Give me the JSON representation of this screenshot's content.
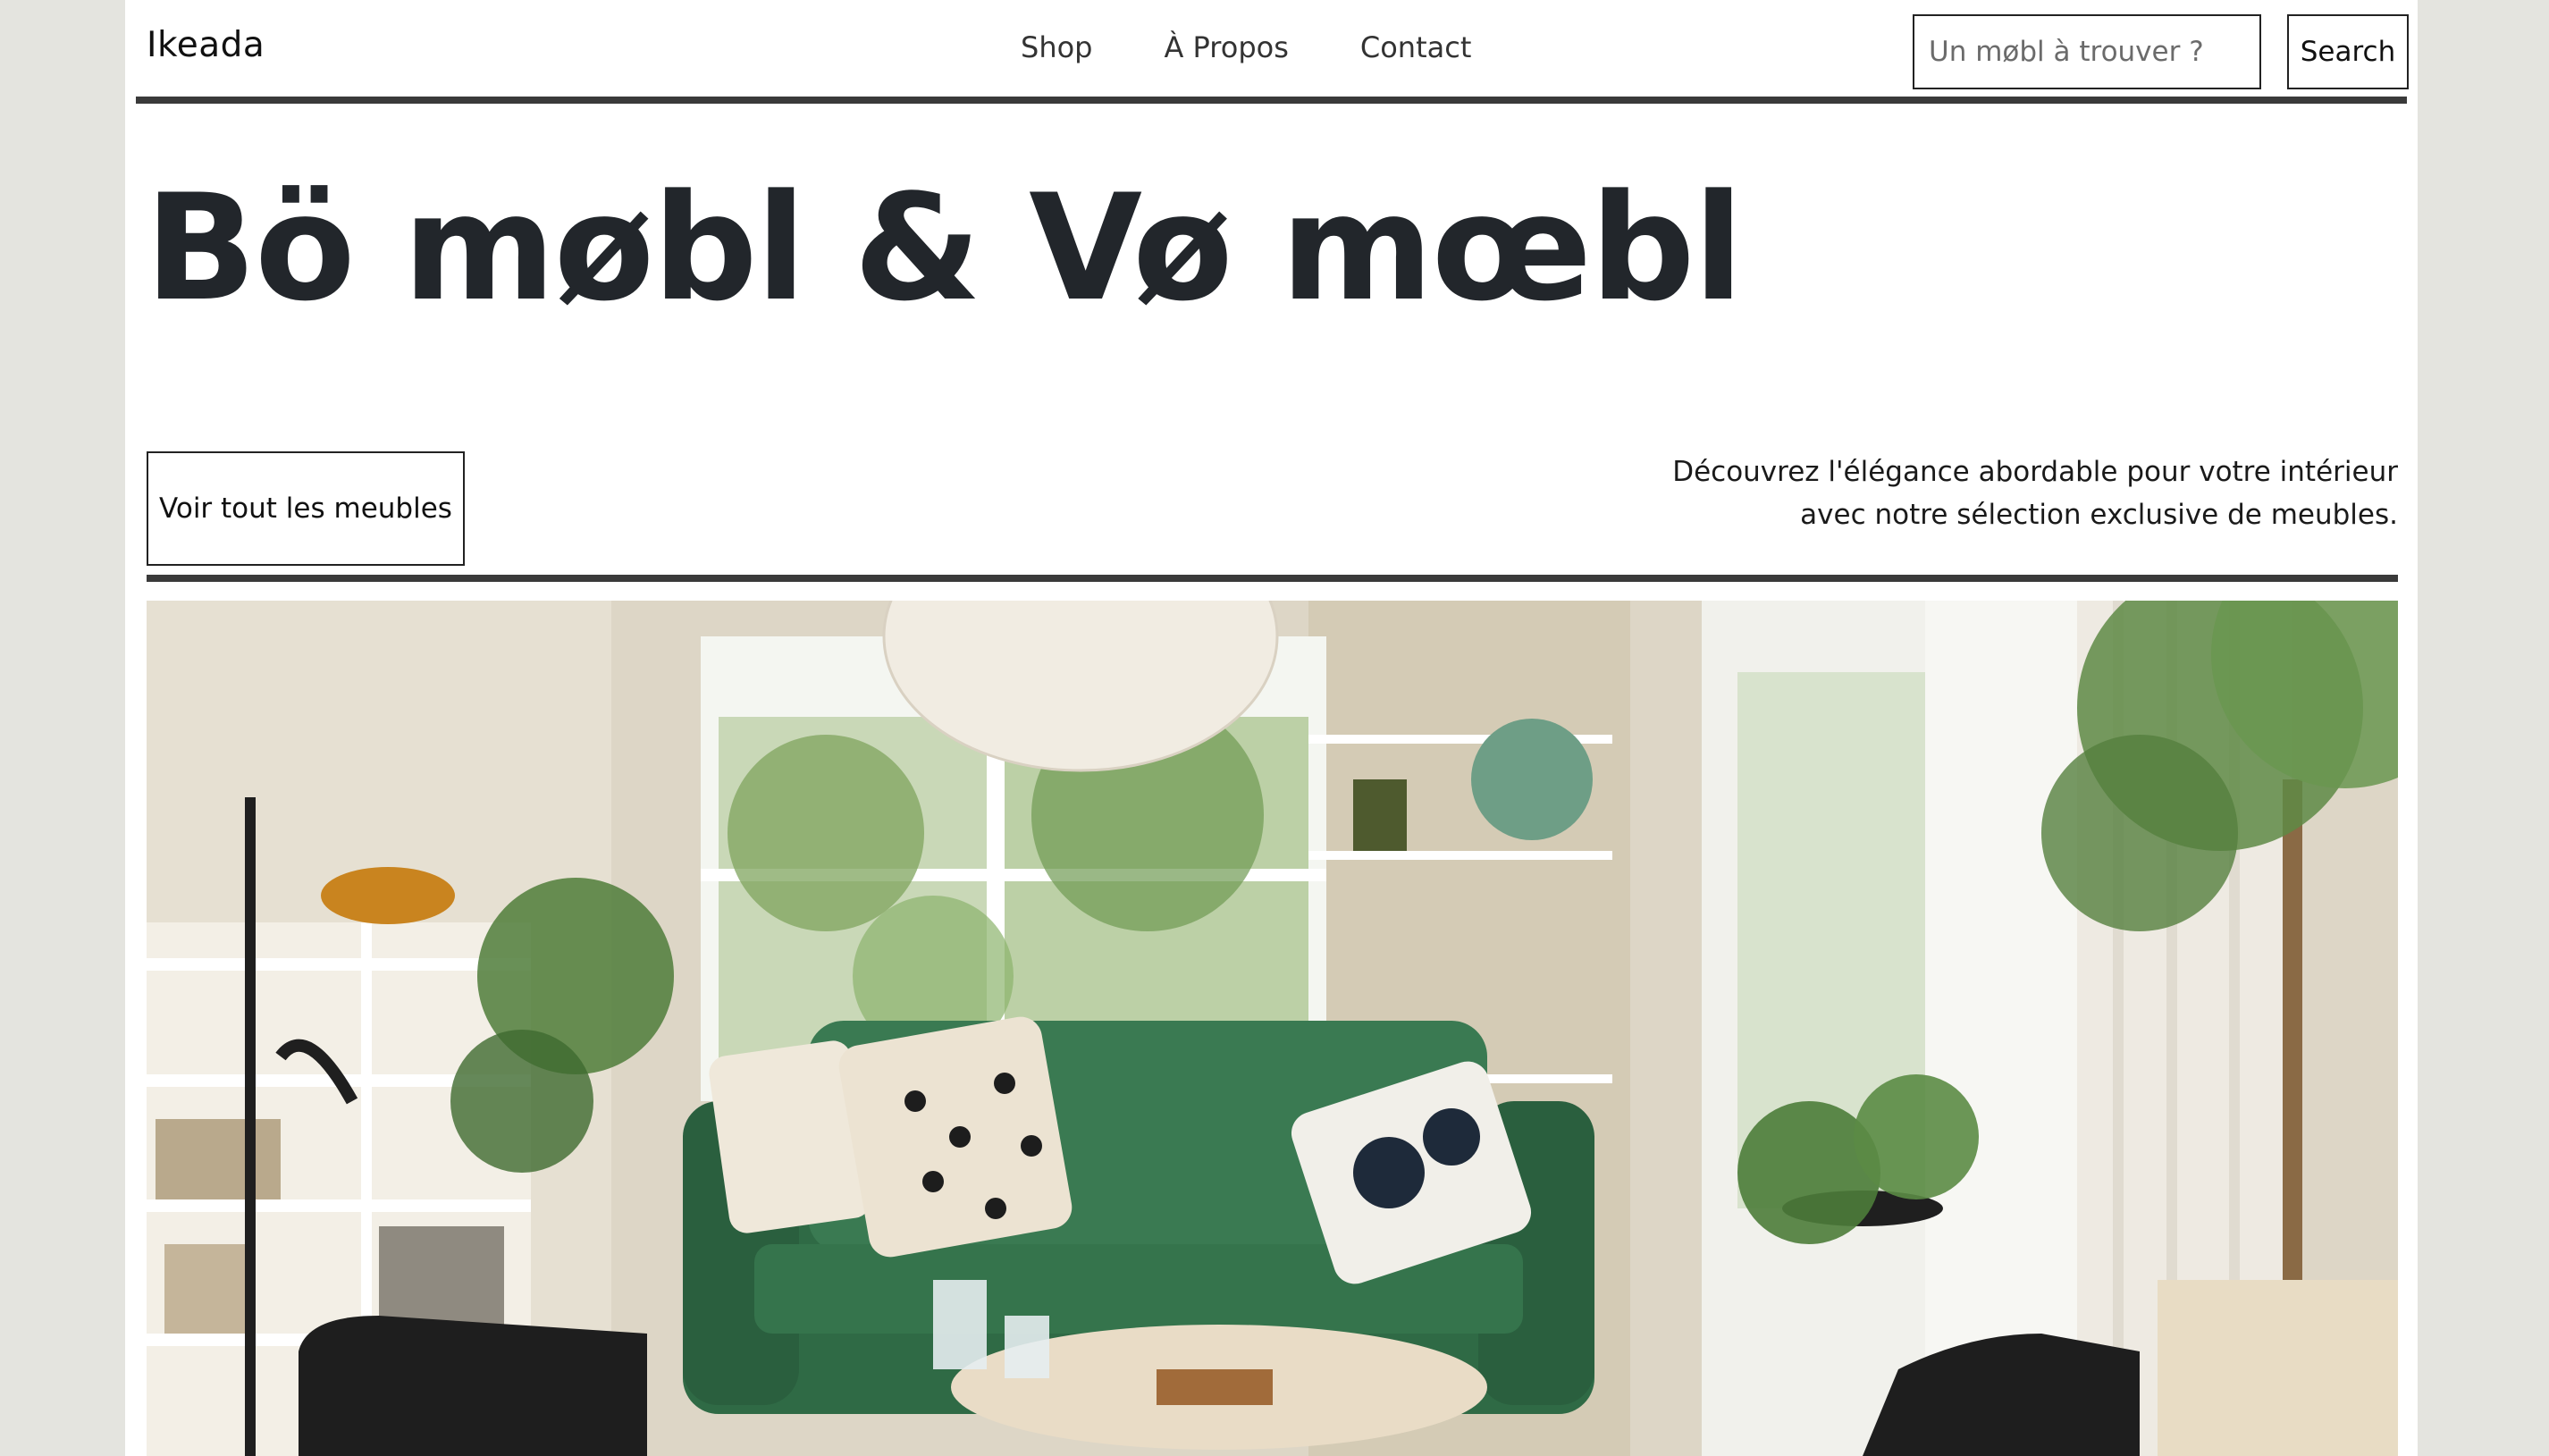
{
  "header": {
    "brand": "Ikeada",
    "nav": [
      {
        "label": "Shop"
      },
      {
        "label": "À Propos"
      },
      {
        "label": "Contact"
      }
    ],
    "search": {
      "placeholder": "Un møbl à trouver ?",
      "value": "",
      "button_label": "Search"
    }
  },
  "hero": {
    "title": "Bö møbl & Vø mœbl",
    "cta_label": "Voir tout les meubles",
    "description": "Découvrez l'élégance abordable pour votre intérieur avec notre sélection exclusive de meubles."
  },
  "colors": {
    "page_background": "#e4e4df",
    "content_background": "#ffffff",
    "text": "#212529",
    "divider": "#3a3a3a",
    "sofa": "#2f6a45"
  },
  "icons": {
    "hero_image": "living-room-photo"
  }
}
